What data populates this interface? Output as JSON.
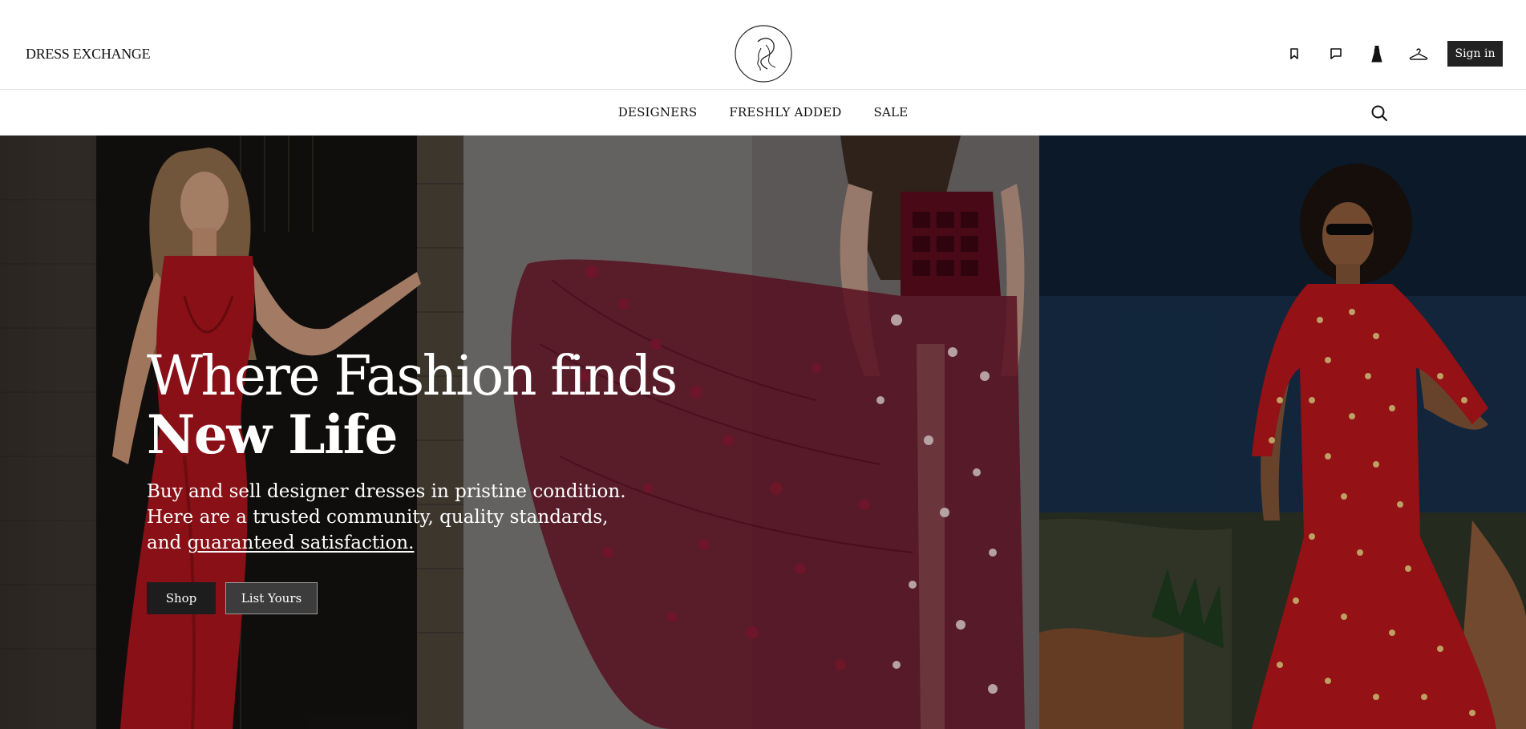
{
  "header": {
    "brand": "DRESS EXCHANGE",
    "logo_icon": "woman-profile-logo-icon",
    "icons": [
      "bookmark-icon",
      "chat-icon",
      "dress-icon",
      "hanger-icon"
    ],
    "signin_label": "Sign in"
  },
  "nav": {
    "items": [
      {
        "label": "DESIGNERS"
      },
      {
        "label": "FRESHLY ADDED"
      },
      {
        "label": "SALE"
      }
    ],
    "search_icon": "search-icon"
  },
  "hero": {
    "headline_line1": "Where Fashion finds",
    "headline_line2": "New Life",
    "subtitle_part1": "Buy and sell designer dresses in pristine condition. Here are a trusted community, quality standards, and ",
    "subtitle_link": "guaranteed satisfaction.",
    "shop_label": "Shop",
    "list_label": "List Yours"
  },
  "colors": {
    "signin_bg": "#222222",
    "dress_red": "#a8141b",
    "gown_burgundy": "#6a1024"
  }
}
